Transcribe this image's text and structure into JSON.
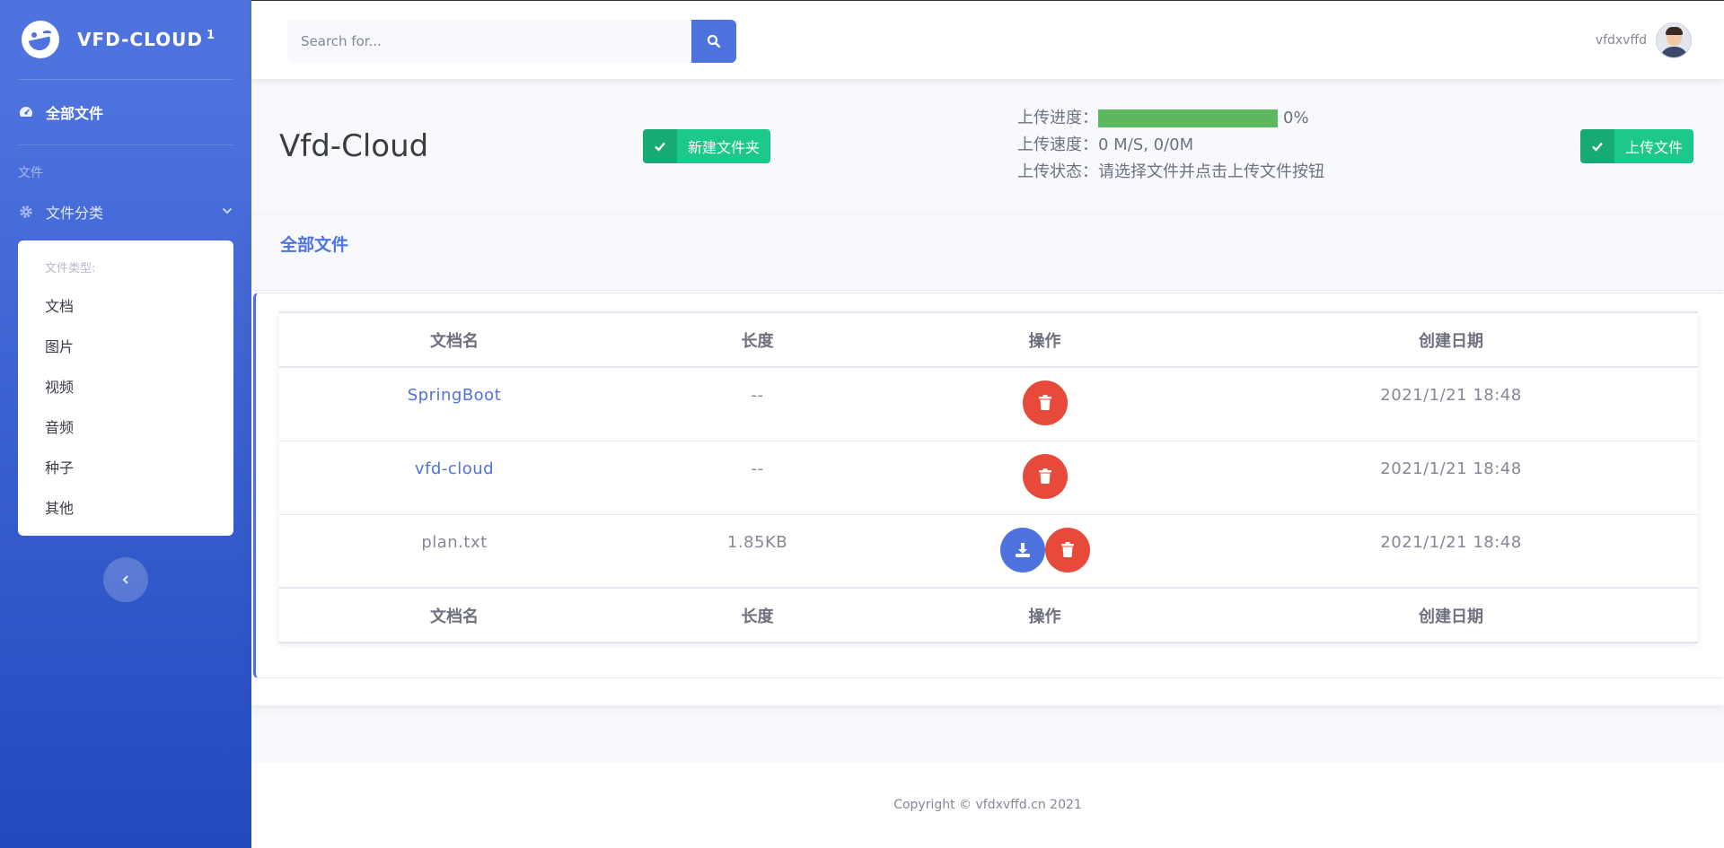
{
  "brand": {
    "name": "VFD-CLOUD",
    "sup": "1"
  },
  "sidebar": {
    "active_item": "全部文件",
    "heading": "文件",
    "collapse_label": "文件分类",
    "submenu_header": "文件类型:",
    "submenu_items": [
      "文档",
      "图片",
      "视频",
      "音频",
      "种子",
      "其他"
    ]
  },
  "topbar": {
    "search_placeholder": "Search for...",
    "user_name": "vfdxvffd"
  },
  "page": {
    "title": "Vfd-Cloud",
    "new_folder_label": "新建文件夹",
    "upload_label": "上传文件"
  },
  "upload": {
    "progress_label": "上传进度：",
    "progress_value": 1.0,
    "progress_text": "0%",
    "speed_label": "上传速度：",
    "speed_value": "0 M/S, 0/0M",
    "status_label": "上传状态：",
    "status_value": "请选择文件并点击上传文件按钮"
  },
  "card": {
    "title": "全部文件",
    "columns": [
      "文档名",
      "长度",
      "操作",
      "创建日期"
    ],
    "rows": [
      {
        "name": "SpringBoot",
        "size": "--",
        "date": "2021/1/21 18:48"
      },
      {
        "name": "vfd-cloud",
        "size": "--",
        "date": "2021/1/21 18:48"
      },
      {
        "name": "plan.txt",
        "size": "1.85KB",
        "date": "2021/1/21 18:48"
      }
    ]
  },
  "footer": {
    "copyright": "Copyright © vfdxvffd.cn 2021"
  },
  "colors": {
    "primary": "#4e73df",
    "success": "#1cc88a",
    "danger": "#e74a3b",
    "progress": "#5cb85c"
  },
  "icons": [
    "tachometer-icon",
    "gear-icon",
    "chevron-down-icon",
    "chevron-left-icon",
    "search-icon",
    "check-icon",
    "trash-icon",
    "download-icon"
  ]
}
